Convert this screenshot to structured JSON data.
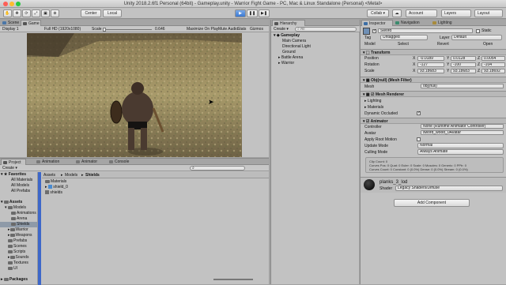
{
  "window": {
    "title": "Unity 2018.2.6f1 Personal (64bit) - Gameplay.unity - Warrior Fight Game - PC, Mac & Linux Standalone (Personal) <Metal>"
  },
  "toolbar": {
    "center": "Center",
    "local": "Local",
    "collab": "Collab ▾",
    "account": "Account",
    "layers": "Layers",
    "layout": "Layout"
  },
  "scene_tabs": {
    "scene": "Scene",
    "game": "Game"
  },
  "game_bar": {
    "display": "Display 1",
    "resolution": "Full HD (1920x1080)",
    "scale_label": "Scale",
    "scale_value": "0.646",
    "maximize": "Maximize On Play",
    "mute": "Mute Audio",
    "stats": "Stats",
    "gizmos": "Gizmos"
  },
  "hierarchy": {
    "tab": "Hierarchy",
    "create": "Create ▾",
    "search_placeholder": "All",
    "root": "Gameplay",
    "items": [
      "Main Camera",
      "Directional Light",
      "Ground",
      "Battle Arena",
      "Warrior"
    ]
  },
  "inspector": {
    "tabs": [
      "Inspector",
      "Navigation",
      "Lighting"
    ],
    "object_name": "Sword",
    "static": "Static",
    "tag_label": "Tag",
    "tag_value": "Untagged",
    "layer_label": "Layer",
    "layer_value": "Default",
    "prefab": {
      "label": "Model",
      "buttons": [
        "Select",
        "Revert",
        "Open"
      ]
    },
    "transform": {
      "title": "Transform",
      "rows": [
        {
          "label": "Position",
          "x": "-0.0189",
          "y": "0.0128",
          "z": "0.0054"
        },
        {
          "label": "Rotation",
          "x": "-127",
          "y": "-100",
          "z": "-104"
        },
        {
          "label": "Scale",
          "x": "93.18683",
          "y": "93.18683",
          "z": "93.18692"
        }
      ]
    },
    "mesh_filter": {
      "title": "Obj(null) (Mesh Filter)",
      "mesh_label": "Mesh",
      "mesh_value": "obj(null)"
    },
    "mesh_renderer": {
      "title": "Mesh Renderer",
      "items": [
        "Lighting",
        "Materials"
      ],
      "dyn_label": "Dynamic Occluded"
    },
    "animator": {
      "title": "Animator",
      "rows": [
        {
          "label": "Controller",
          "value": "None (Runtime Animator Controller)"
        },
        {
          "label": "Avatar",
          "value": "sword_wood_0Avatar"
        },
        {
          "label": "Apply Root Motion",
          "value": ""
        },
        {
          "label": "Update Mode",
          "value": "Normal"
        },
        {
          "label": "Culling Mode",
          "value": "Always Animate"
        }
      ],
      "info": [
        "Clip Count: 0",
        "Curves Pos: 0 Quat: 0 Euler: 0 Scale: 0 Muscles: 0 Generic: 0 PPtr: 0",
        "Curves Count: 0 Constant: 0 (0.0%) Dense: 0 (0.0%) Stream: 0 (0.0%)"
      ]
    },
    "material": {
      "name": "planks_3_lod",
      "shader_label": "Shader",
      "shader_value": "Legacy Shaders/Diffuse"
    },
    "add_component": "Add Component"
  },
  "project": {
    "tabs": [
      "Project",
      "Animation",
      "Animator",
      "Console"
    ],
    "create": "Create ▾",
    "favorites": [
      "Favorites",
      "All Materials",
      "All Models",
      "All Prefabs"
    ],
    "assets_tree": [
      "Assets",
      "Models",
      "Animations",
      "Arena",
      "Shields",
      "Warrior",
      "Weapons",
      "Prefabs",
      "Scenes",
      "Scripts",
      "Sounds",
      "Textures",
      "UI",
      "Packages"
    ],
    "breadcrumb": [
      "Assets",
      "Models",
      "Shields"
    ],
    "files": [
      "Materials",
      "shield_0",
      "shields"
    ]
  }
}
